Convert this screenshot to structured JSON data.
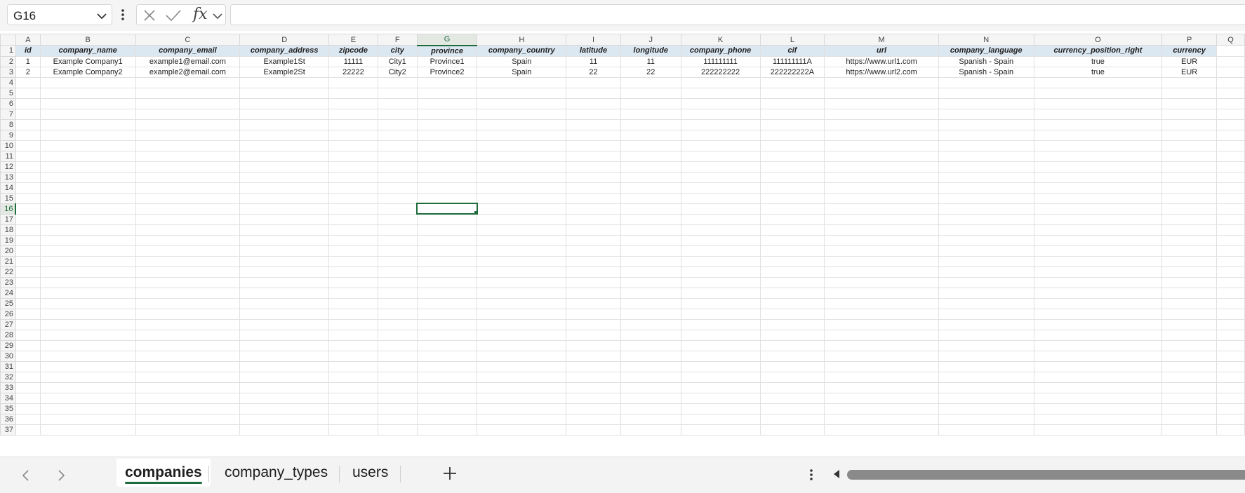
{
  "formula_bar": {
    "name_box": "G16",
    "formula": ""
  },
  "columns": [
    "A",
    "B",
    "C",
    "D",
    "E",
    "F",
    "G",
    "H",
    "I",
    "J",
    "K",
    "L",
    "M",
    "N",
    "O",
    "P",
    "Q"
  ],
  "selected": {
    "column": "G",
    "row": 16,
    "cell": "G16"
  },
  "header_row": [
    "id",
    "company_name",
    "company_email",
    "company_address",
    "zipcode",
    "city",
    "province",
    "company_country",
    "latitude",
    "longitude",
    "company_phone",
    "cif",
    "url",
    "company_language",
    "currency_position_right",
    "currency"
  ],
  "data_rows": [
    [
      "1",
      "Example Company1",
      "example1@email.com",
      "Example1St",
      "11111",
      "City1",
      "Province1",
      "Spain",
      "11",
      "11",
      "111111111",
      "111111111A",
      "https://www.url1.com",
      "Spanish - Spain",
      "true",
      "EUR"
    ],
    [
      "2",
      "Example Company2",
      "example2@email.com",
      "Example2St",
      "22222",
      "City2",
      "Province2",
      "Spain",
      "22",
      "22",
      "222222222",
      "222222222A",
      "https://www.url2.com",
      "Spanish - Spain",
      "true",
      "EUR"
    ]
  ],
  "row_count": 37,
  "sheets": [
    "companies",
    "company_types",
    "users"
  ],
  "active_sheet": "companies",
  "colors": {
    "accent": "#1e6b3c",
    "header_fill": "#dbe7f1",
    "grid_line": "#e1e1e1"
  },
  "icons": {
    "name_box_dropdown": "chevron-down-icon",
    "more": "vertical-dots-icon",
    "cancel": "x-icon",
    "enter": "check-icon",
    "function": "fx-icon",
    "prev_sheet": "chevron-left-icon",
    "next_sheet": "chevron-right-icon",
    "add_sheet": "plus-icon"
  }
}
